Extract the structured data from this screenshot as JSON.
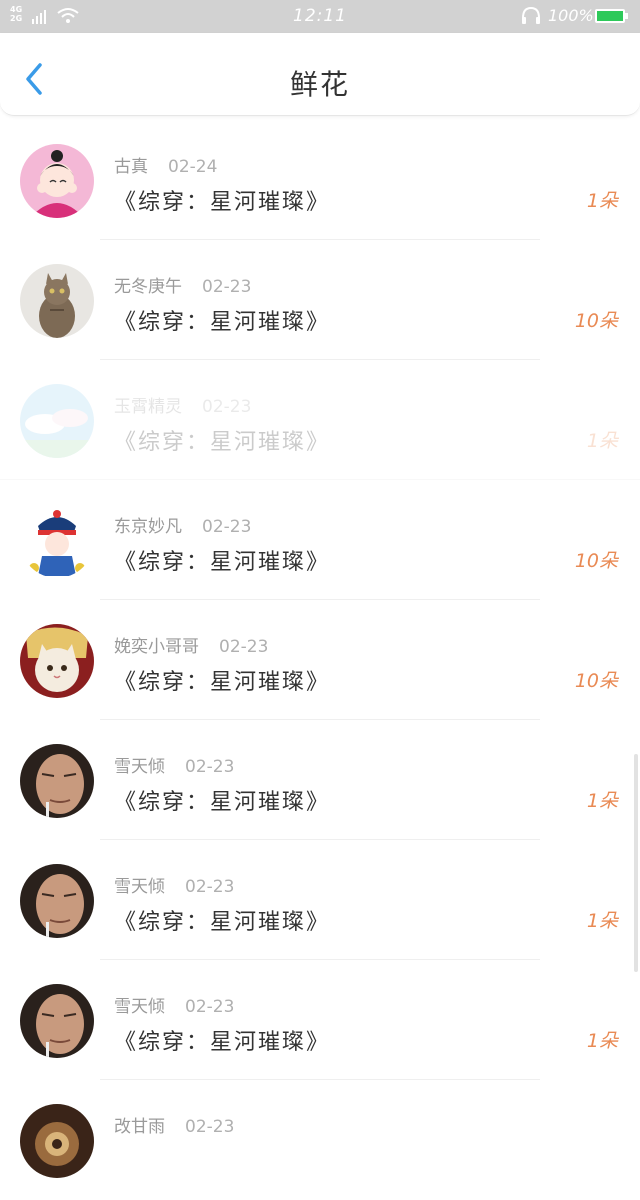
{
  "status_bar": {
    "network_top": "4G",
    "network_bottom": "2G",
    "time": "12:11",
    "battery": "100%",
    "battery_color": "#2ec95a"
  },
  "header": {
    "title": "鲜花",
    "back_icon": "chevron-left-icon",
    "accent_color": "#3a9be8"
  },
  "list": [
    {
      "name": "古真",
      "date": "02-24",
      "book": "《综穿：星河璀璨》",
      "count": "1朵"
    },
    {
      "name": "无冬庚午",
      "date": "02-23",
      "book": "《综穿：星河璀璨》",
      "count": "10朵"
    },
    {
      "name": "玉霄精灵",
      "date": "02-23",
      "book": "《综穿：星河璀璨》",
      "count": "1朵"
    },
    {
      "name": "东京妙凡",
      "date": "02-23",
      "book": "《综穿：星河璀璨》",
      "count": "10朵"
    },
    {
      "name": "娩奕小哥哥",
      "date": "02-23",
      "book": "《综穿：星河璀璨》",
      "count": "10朵"
    },
    {
      "name": "雪天倾",
      "date": "02-23",
      "book": "《综穿：星河璀璨》",
      "count": "1朵"
    },
    {
      "name": "雪天倾",
      "date": "02-23",
      "book": "《综穿：星河璀璨》",
      "count": "1朵"
    },
    {
      "name": "雪天倾",
      "date": "02-23",
      "book": "《综穿：星河璀璨》",
      "count": "1朵"
    },
    {
      "name": "改甘雨",
      "date": "02-23",
      "book": "",
      "count": ""
    }
  ]
}
